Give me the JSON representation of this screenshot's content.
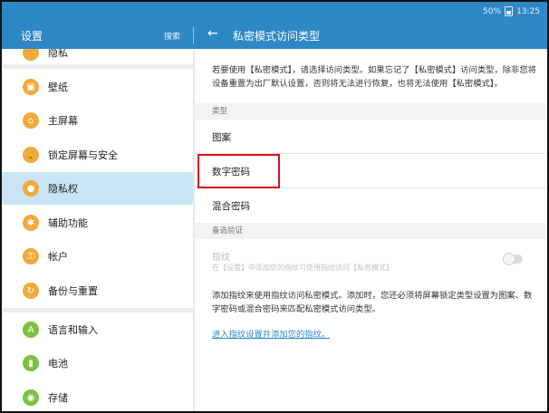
{
  "status_bar": {
    "battery": "50%",
    "time": "13:25"
  },
  "app_bar": {
    "left_title": "设置",
    "search": "搜索",
    "right_title": "私密模式访问类型"
  },
  "sidebar": {
    "partial_item": "隐私",
    "items": [
      {
        "label": "壁纸",
        "color": "#f3a93b",
        "glyph": "▣"
      },
      {
        "label": "主屏幕",
        "color": "#f3a93b",
        "glyph": "⌂"
      },
      {
        "label": "锁定屏幕与安全",
        "color": "#f3a93b",
        "glyph": "🔒"
      },
      {
        "label": "隐私权",
        "color": "#f3a93b",
        "glyph": "●"
      },
      {
        "label": "辅助功能",
        "color": "#f3a93b",
        "glyph": "✱"
      },
      {
        "label": "帐户",
        "color": "#f3a93b",
        "glyph": "⚿"
      },
      {
        "label": "备份与重置",
        "color": "#f3a93b",
        "glyph": "↻"
      },
      {
        "label": "语言和输入",
        "color": "#7cc142",
        "glyph": "A"
      },
      {
        "label": "电池",
        "color": "#7cc142",
        "glyph": "▮"
      },
      {
        "label": "存储",
        "color": "#7cc142",
        "glyph": "◉"
      }
    ]
  },
  "main": {
    "intro": "若要使用【私密模式】，请选择访问类型。如果忘记了【私密模式】访问类型，除非您将设备重置为出厂默认设置，否则将无法进行恢复，也将无法使用【私密模式】。",
    "section_type": "类型",
    "options": [
      "图案",
      "数字密码",
      "混合密码"
    ],
    "section_backup": "备选验证",
    "fingerprint_title": "指纹",
    "fingerprint_sub": "在【设置】中添加您的指纹可使用指纹访问【私密模式】",
    "fingerprint_desc": "添加指纹来使用指纹访问私密模式。添加时，您还必须将屏幕锁定类型设置为图案、数字密码或混合密码来匹配私密模式访问类型。",
    "fingerprint_link": "进入指纹设置并添加您的指纹。"
  }
}
